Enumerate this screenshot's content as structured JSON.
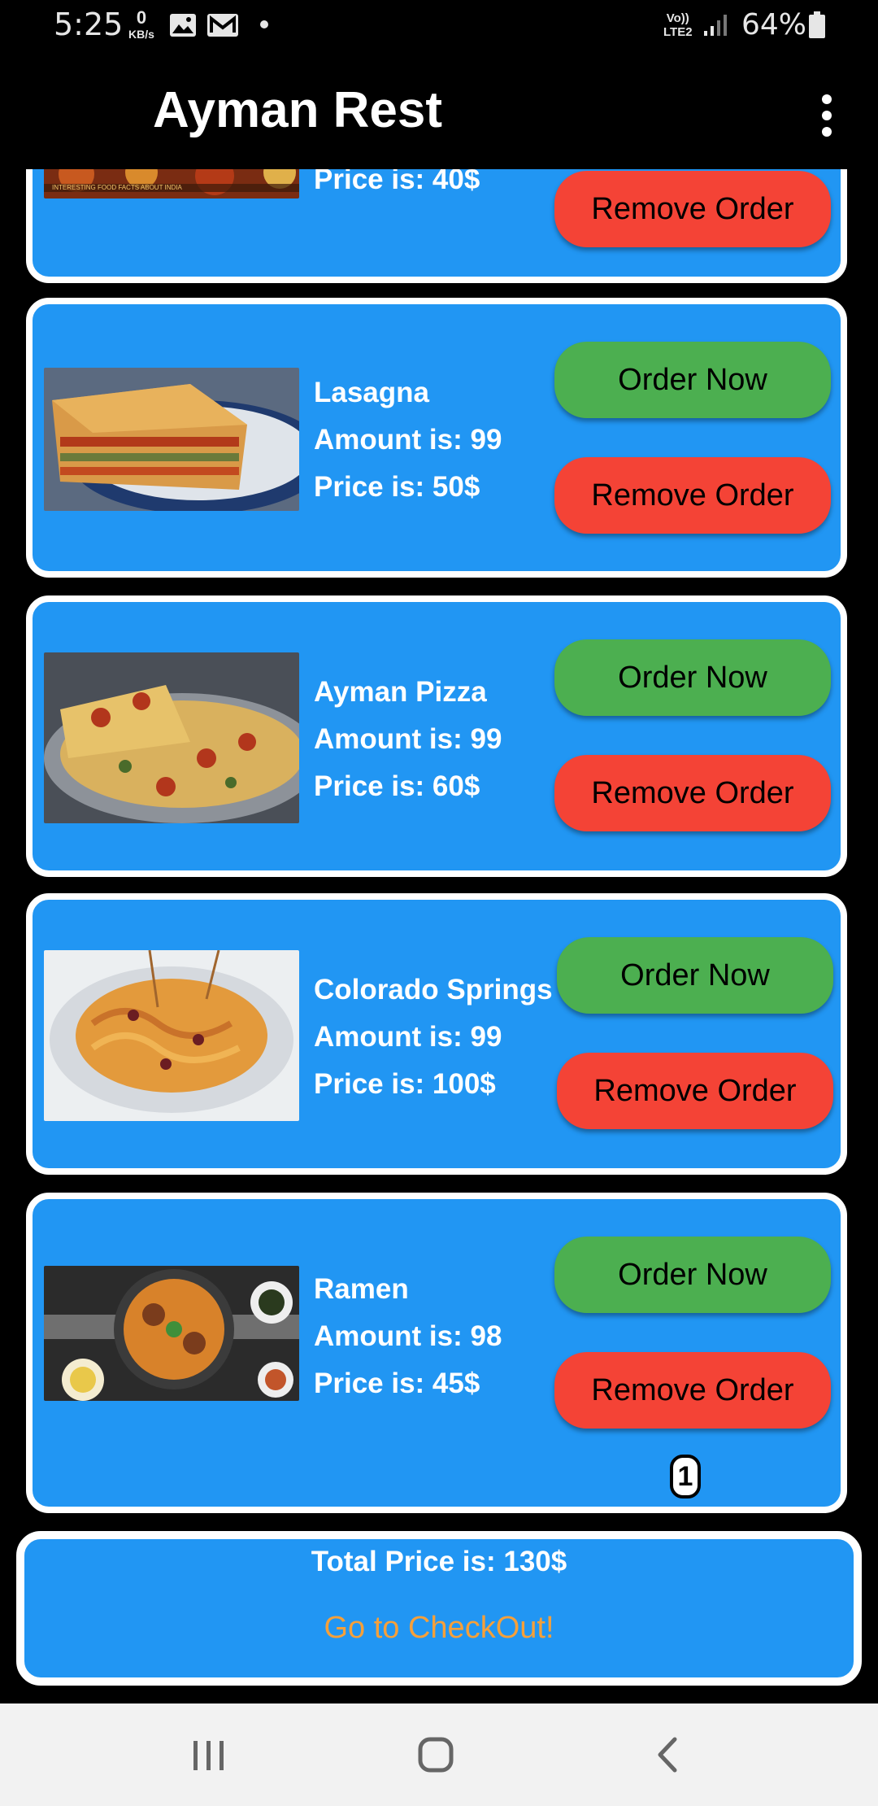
{
  "status_bar": {
    "time": "5:25",
    "net_speed_value": "0",
    "net_speed_unit": "KB/s",
    "icons": [
      "gallery-icon",
      "gmail-icon",
      "notification-dot-icon"
    ],
    "volte": "Vo))",
    "network": "LTE2",
    "battery": "64%"
  },
  "app_bar": {
    "title": "Ayman Rest",
    "menu_icon": "more-vert-icon"
  },
  "list": {
    "order_label": "Order Now",
    "remove_label": "Remove Order",
    "items": [
      {
        "name": "",
        "amount": "",
        "price": "Price is: 40$",
        "image_caption": "INTERESTING FOOD FACTS ABOUT INDIA"
      },
      {
        "name": "Lasagna",
        "amount": "Amount is: 99",
        "price": "Price is: 50$"
      },
      {
        "name": "Ayman Pizza",
        "amount": "Amount is: 99",
        "price": "Price is: 60$"
      },
      {
        "name": "Colorado Springs",
        "amount": "Amount is: 99",
        "price": "Price is: 100$"
      },
      {
        "name": "Ramen",
        "amount": "Amount is: 98",
        "price": "Price is: 45$",
        "badge": "1"
      }
    ]
  },
  "footer": {
    "total": "Total Price is: 130$",
    "checkout_label": "Go to CheckOut!"
  },
  "colors": {
    "card_bg": "#2196f3",
    "order_button": "#4caf50",
    "remove_button": "#f44336",
    "checkout_text": "#f5a03a"
  },
  "nav_bar": {
    "recents_icon": "recents-icon",
    "home_icon": "home-icon",
    "back_icon": "back-icon"
  }
}
